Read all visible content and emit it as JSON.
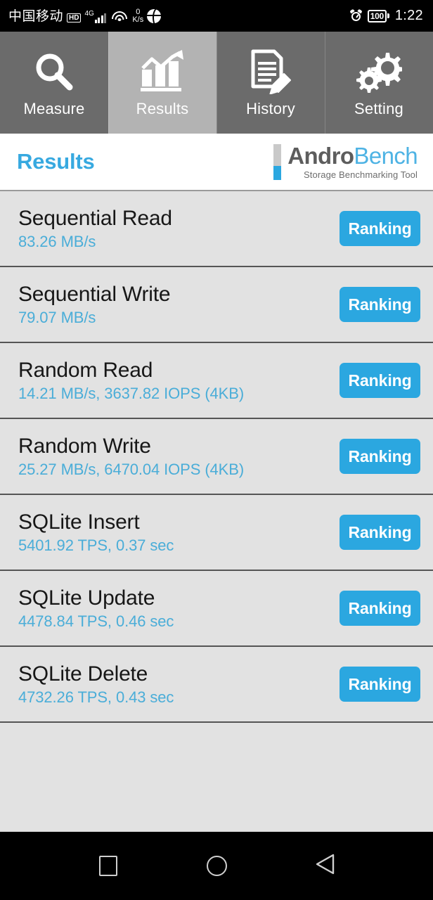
{
  "status_bar": {
    "carrier": "中国移动",
    "hd_badge": "HD",
    "network_type": "4G",
    "data_speed_value": "0",
    "data_speed_unit": "K/s",
    "battery_level": "100",
    "time": "1:22",
    "icons": [
      "hd-icon",
      "signal-bars-icon",
      "wifi-icon",
      "data-speed-icon",
      "globe-icon",
      "alarm-icon",
      "battery-icon"
    ]
  },
  "tabs": [
    {
      "label": "Measure",
      "icon": "magnifier-icon",
      "selected": false
    },
    {
      "label": "Results",
      "icon": "bar-chart-icon",
      "selected": true
    },
    {
      "label": "History",
      "icon": "document-pencil-icon",
      "selected": false
    },
    {
      "label": "Setting",
      "icon": "gears-icon",
      "selected": false
    }
  ],
  "header": {
    "page_title": "Results",
    "logo_primary": "Andro",
    "logo_secondary": "Bench",
    "logo_subtitle": "Storage Benchmarking Tool"
  },
  "results": [
    {
      "title": "Sequential Read",
      "value": "83.26 MB/s",
      "button": "Ranking"
    },
    {
      "title": "Sequential Write",
      "value": "79.07 MB/s",
      "button": "Ranking"
    },
    {
      "title": "Random Read",
      "value": "14.21 MB/s, 3637.82 IOPS (4KB)",
      "button": "Ranking"
    },
    {
      "title": "Random Write",
      "value": "25.27 MB/s, 6470.04 IOPS (4KB)",
      "button": "Ranking"
    },
    {
      "title": "SQLite Insert",
      "value": "5401.92 TPS, 0.37 sec",
      "button": "Ranking"
    },
    {
      "title": "SQLite Update",
      "value": "4478.84 TPS, 0.46 sec",
      "button": "Ranking"
    },
    {
      "title": "SQLite Delete",
      "value": "4732.26 TPS, 0.43 sec",
      "button": "Ranking"
    }
  ],
  "nav_bar": {
    "buttons": [
      {
        "name": "recents-icon"
      },
      {
        "name": "home-icon"
      },
      {
        "name": "back-icon"
      }
    ]
  },
  "colors": {
    "accent_blue": "#2ba7e0",
    "title_blue": "#37a9e0",
    "value_blue": "#4aadd8",
    "tab_unselected": "#6b6b6b",
    "tab_selected": "#b3b3b3",
    "list_background": "#e2e2e2",
    "divider": "#555555"
  }
}
